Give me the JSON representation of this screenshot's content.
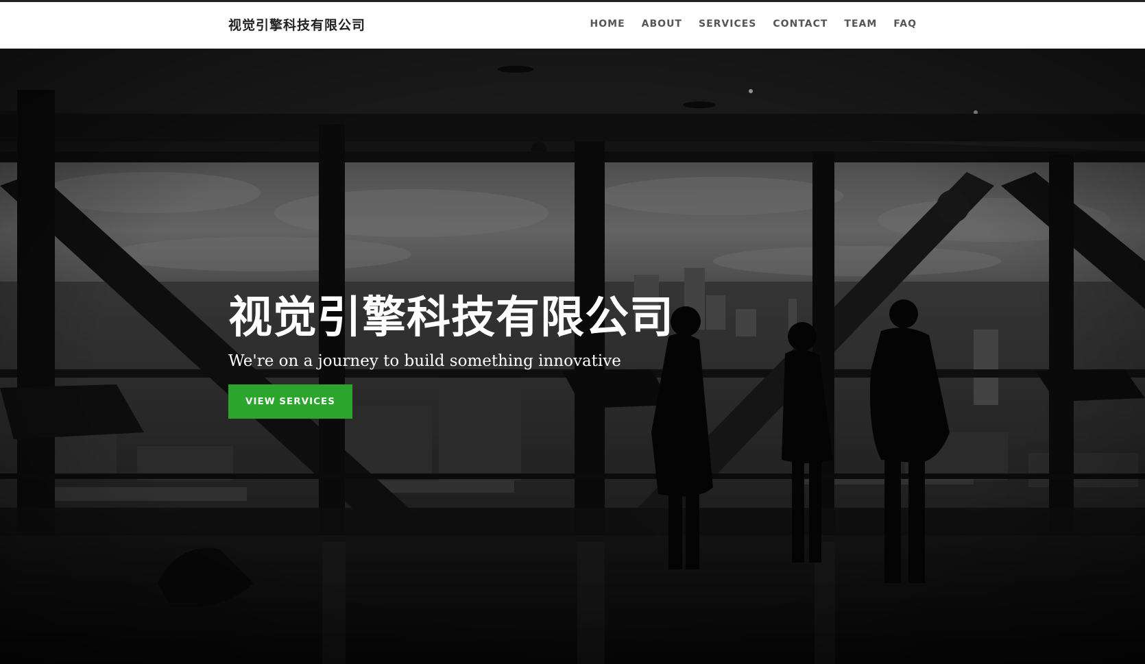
{
  "navbar": {
    "brand": "视觉引擎科技有限公司",
    "links": [
      {
        "label": "HOME"
      },
      {
        "label": "ABOUT"
      },
      {
        "label": "SERVICES"
      },
      {
        "label": "CONTACT"
      },
      {
        "label": "TEAM"
      },
      {
        "label": "FAQ"
      }
    ]
  },
  "hero": {
    "title": "视觉引擎科技有限公司",
    "subtitle": "We're on a journey to build something innovative",
    "cta_label": "VIEW SERVICES",
    "cta_color": "#2ba52b",
    "background_image": "office-silhouettes-city-view"
  }
}
